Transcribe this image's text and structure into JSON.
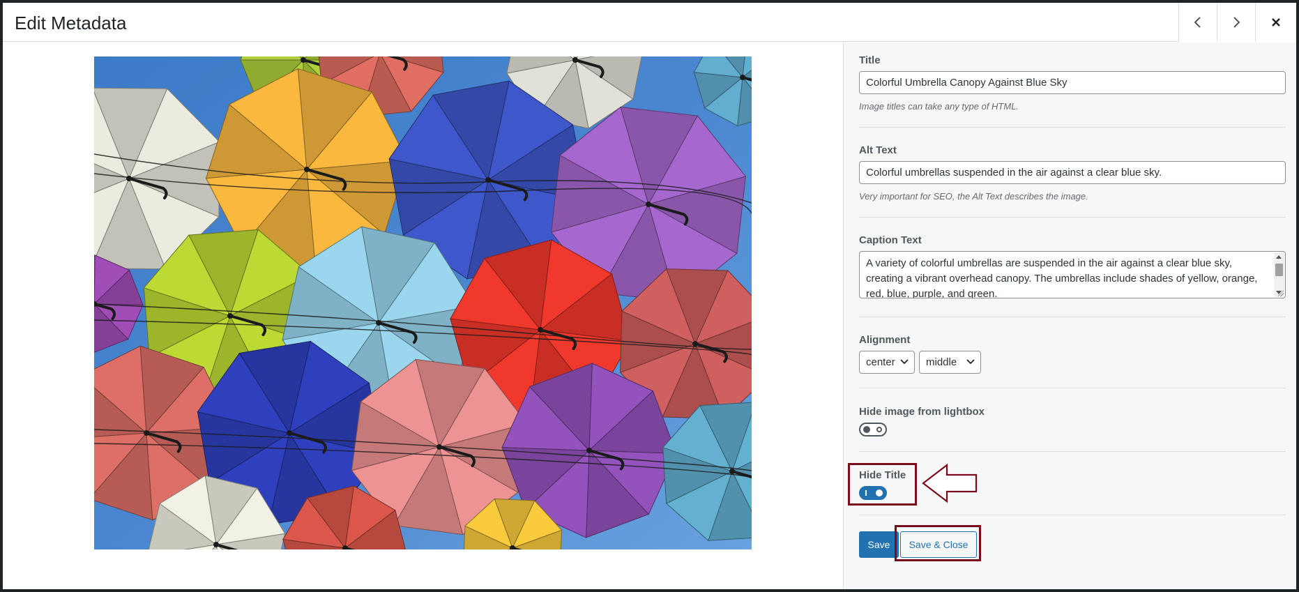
{
  "modal": {
    "title": "Edit Metadata"
  },
  "image": {
    "alt": "Colorful umbrellas suspended in the air against a clear blue sky."
  },
  "fields": {
    "title": {
      "label": "Title",
      "value": "Colorful Umbrella Canopy Against Blue Sky",
      "help": "Image titles can take any type of HTML."
    },
    "alt": {
      "label": "Alt Text",
      "value": "Colorful umbrellas suspended in the air against a clear blue sky.",
      "help": "Very important for SEO, the Alt Text describes the image."
    },
    "caption": {
      "label": "Caption Text",
      "value": "A variety of colorful umbrellas are suspended in the air against a clear blue sky, creating a vibrant overhead canopy. The umbrellas include shades of yellow, orange, red, blue, purple, and green."
    },
    "alignment": {
      "label": "Alignment",
      "horizontal": "center",
      "vertical": "middle"
    },
    "hide_lightbox": {
      "label": "Hide image from lightbox",
      "enabled": false
    },
    "hide_title": {
      "label": "Hide Title",
      "enabled": true
    }
  },
  "actions": {
    "save_label": "Save",
    "save_close_label": "Save & Close"
  },
  "colors": {
    "accent": "#2271b1",
    "annotation": "#7a0b1c",
    "sidebar_bg": "#f6f7f7",
    "sky": "#4a86d0"
  },
  "icons": {
    "prev": "chevron-left-icon",
    "next": "chevron-right-icon",
    "close": "close-icon",
    "arrow": "left-arrow-annotation"
  }
}
